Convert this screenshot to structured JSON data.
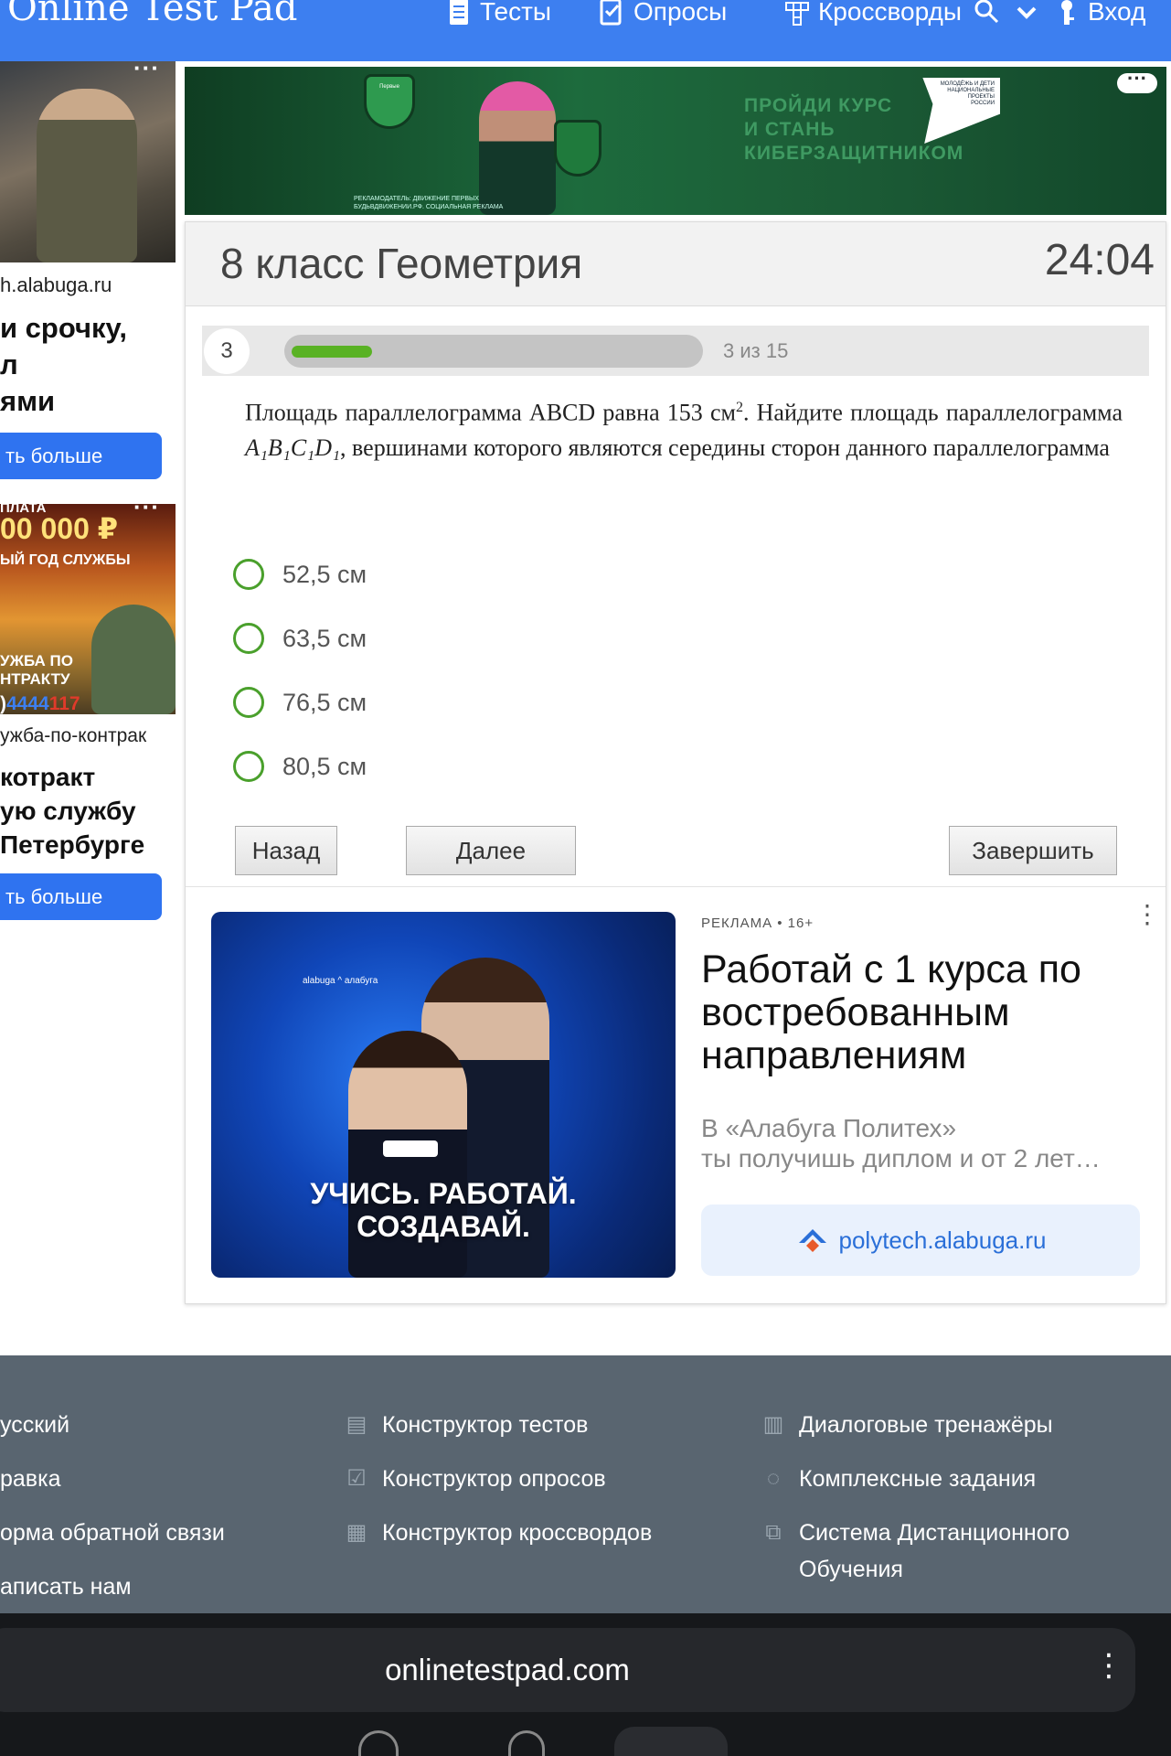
{
  "header": {
    "logo": "Online Test Pad",
    "nav": [
      {
        "label": "Тесты",
        "icon": "test-doc-icon"
      },
      {
        "label": "Опросы",
        "icon": "poll-icon"
      },
      {
        "label": "Кроссворды",
        "icon": "crossword-icon"
      }
    ],
    "login": "Вход",
    "search_icon": "search-icon",
    "dropdown_icon": "chevron-down-icon",
    "login_icon": "key-icon",
    "color": "#3d7ff0"
  },
  "left_ads": {
    "ad1": {
      "domain": "h.alabuga.ru",
      "headline": [
        "и срочку,",
        "л",
        "ями"
      ],
      "button": "ть больше"
    },
    "ad2": {
      "top": "ПЛАТА",
      "sum": "00 000 ₽",
      "sub": "ЫЙ ГОД СЛУЖБЫ",
      "mid": [
        "УЖБА ПО",
        "НТРАКТУ"
      ],
      "phone_a": ")",
      "phone_b": "4444",
      "phone_c": "117",
      "domain": "ужба-по-контрак",
      "headline": [
        "котракт",
        "ую службу",
        "Петербурге"
      ],
      "button": "ть больше"
    }
  },
  "banner": {
    "text": [
      "ПРОЙДИ КУРС",
      "И СТАНЬ",
      "КИБЕРЗАЩИТНИКОМ"
    ],
    "small": [
      "РЕКЛАМОДАТЕЛЬ: ДВИЖЕНИЕ ПЕРВЫХ",
      "БУДЬВДВИЖЕНИИ.РФ. СОЦИАЛЬНАЯ РЕКЛАМА"
    ],
    "logo": [
      "МОЛОДЁЖЬ И ДЕТИ",
      "НАЦИОНАЛЬНЫЕ",
      "ПРОЕКТЫ",
      "РОССИИ"
    ],
    "shield_label": "Первые"
  },
  "test": {
    "title": "8 класс Геометрия",
    "timer": "24:04",
    "question_number": "3",
    "progress_label": "3 из 15",
    "progress_fraction": 0.2,
    "question_parts": {
      "p1": "Площадь параллелограмма ABCD равна 153 см",
      "sup": "2",
      "p2": ". Найдите площадь параллелограмма ",
      "vertices": "A₁B₁C₁D₁",
      "p3": ", вершинами которого являются середины сторон данного параллелограмма"
    },
    "answers": [
      "52,5 см",
      "63,5 см",
      "76,5 см",
      "80,5 см"
    ],
    "buttons": {
      "back": "Назад",
      "next": "Далее",
      "finish": "Завершить"
    }
  },
  "native_ad": {
    "meta": "РЕКЛАМА • 16+",
    "title": "Работай с 1 курса по востребованным направлениям",
    "desc_line1": "В «Алабуга Политех»",
    "desc_line2": "ты получишь диплом и от 2 лет…",
    "link": "polytech.alabuga.ru",
    "image_logo": "alabuga ^ алабуга",
    "slogan_line1": "УЧИСЬ. РАБОТАЙ.",
    "slogan_line2": "СОЗДАВАЙ."
  },
  "footer": {
    "col1": [
      "усский",
      "равка",
      "орма обратной связи",
      "аписать нам"
    ],
    "col2": [
      {
        "label": "Конструктор тестов",
        "icon": "test-doc-icon"
      },
      {
        "label": "Конструктор опросов",
        "icon": "poll-icon"
      },
      {
        "label": "Конструктор кроссвордов",
        "icon": "crossword-icon"
      }
    ],
    "col3": [
      {
        "label": "Диалоговые тренажёры",
        "icon": "clipboard-icon"
      },
      {
        "label": "Комплексные задания",
        "icon": "chat-bubbles-icon"
      },
      {
        "label": "Системa Дистанционного",
        "icon": "layers-icon",
        "label2": "Обучения"
      }
    ],
    "color": "#596570"
  },
  "browser": {
    "url": "onlinetestpad.com",
    "menu_icon": "more-vertical-icon"
  }
}
